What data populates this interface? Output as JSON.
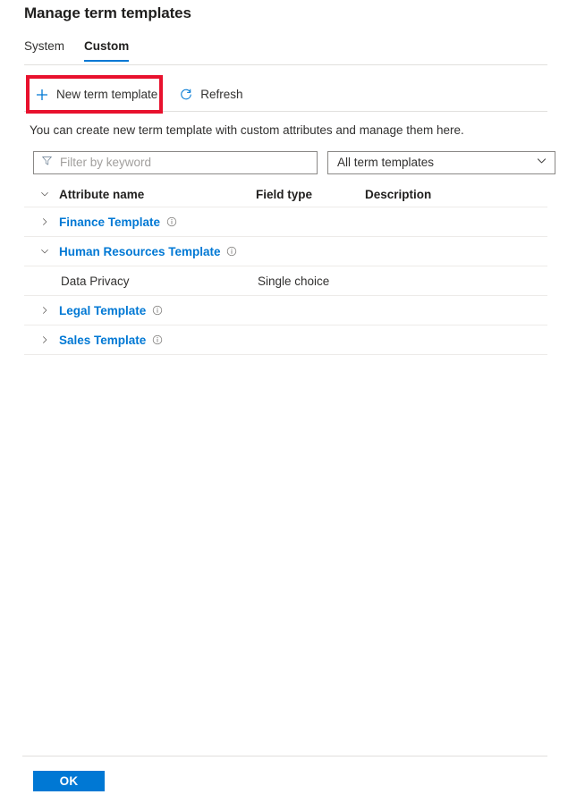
{
  "page": {
    "title": "Manage term templates",
    "description": "You can create new term template with custom attributes and manage them here."
  },
  "tabs": [
    {
      "label": "System",
      "selected": false
    },
    {
      "label": "Custom",
      "selected": true
    }
  ],
  "toolbar": {
    "new_label": "New term template",
    "new_icon": "plus-icon",
    "refresh_label": "Refresh",
    "refresh_icon": "refresh-icon",
    "highlight_color": "#e8112d"
  },
  "filter": {
    "placeholder": "Filter by keyword",
    "value": "",
    "icon": "funnel-icon",
    "dropdown_value": "All term templates",
    "dropdown_icon": "chevron-down-icon"
  },
  "table": {
    "headers": {
      "chevron": "",
      "name": "Attribute name",
      "type": "Field type",
      "description": "Description"
    },
    "rows": [
      {
        "name": "Finance Template",
        "type": "",
        "description": "",
        "expanded": false,
        "chevron": "chevron-right-icon",
        "info": "info-icon",
        "is_child": false
      },
      {
        "name": "Human Resources Template",
        "type": "",
        "description": "",
        "expanded": true,
        "chevron": "chevron-down-icon",
        "info": "info-icon",
        "is_child": false
      },
      {
        "name": "Data Privacy",
        "type": "Single choice",
        "description": "",
        "expanded": false,
        "chevron": "",
        "info": "",
        "is_child": true
      },
      {
        "name": "Legal Template",
        "type": "",
        "description": "",
        "expanded": false,
        "chevron": "chevron-right-icon",
        "info": "info-icon",
        "is_child": false
      },
      {
        "name": "Sales Template",
        "type": "",
        "description": "",
        "expanded": false,
        "chevron": "chevron-right-icon",
        "info": "info-icon",
        "is_child": false
      }
    ]
  },
  "footer": {
    "ok_label": "OK",
    "ok_color": "#0078d4"
  }
}
